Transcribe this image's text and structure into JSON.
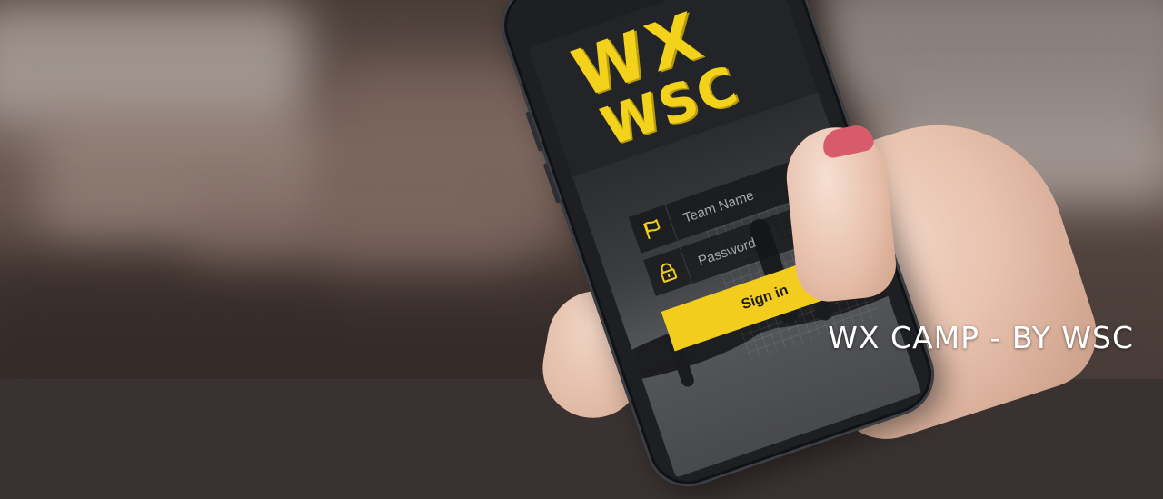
{
  "app": {
    "logo_line1": "WX",
    "logo_line2": "WSC",
    "accent_color": "#f2cd1d"
  },
  "login": {
    "team_name_placeholder": "Team Name",
    "team_name_icon": "flag-icon",
    "password_placeholder": "Password",
    "password_icon": "lock-icon",
    "signin_label": "Sign in"
  },
  "banner": {
    "caption": "WX CAMP - BY WSC"
  }
}
